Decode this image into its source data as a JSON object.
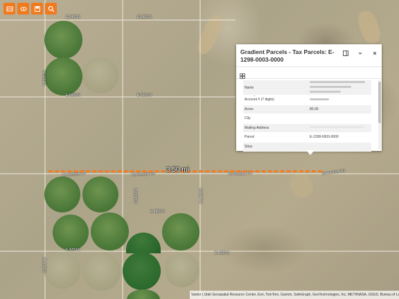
{
  "toolbar": {
    "buttons": [
      {
        "name": "basemap-icon",
        "label": ""
      },
      {
        "name": "layers-icon",
        "label": ""
      },
      {
        "name": "bookmark-icon",
        "label": ""
      },
      {
        "name": "search-icon",
        "label": ""
      }
    ]
  },
  "roads": {
    "e6400n": "E 6400 N",
    "e6400n_2": "E 6400 N",
    "e5600n": "E 5600 N",
    "e5600n_2": "E 5600 N",
    "s3100w": "S 3100 W",
    "w_antelope_rd_1": "W Antelope Rd",
    "w_antelope_rd_2": "W Antelope Rd",
    "w_antelope_rd_3": "W Antelope Rd",
    "w_antelope_rd_4": "W Antelope Rd",
    "e4200n": "E 4200 N",
    "e4800n": "E 4800 N",
    "e4000n": "E 4000 N",
    "s2000w": "S 2000 W",
    "s1400w": "S 1400 W",
    "s1800w": "S 1800 W"
  },
  "measurement": {
    "label": "3.50 mi",
    "color": "#f47c20"
  },
  "popup": {
    "title": "Gradient Parcels - Tax Parcels: E-1298-0003-0000",
    "zoom_to": "Zoom to",
    "rows": [
      {
        "key": "Name",
        "value": ""
      },
      {
        "key": "Account # (7 digits)",
        "value": ""
      },
      {
        "key": "Acres",
        "value": "80.00"
      },
      {
        "key": "City",
        "value": ""
      },
      {
        "key": "Mailing Address",
        "value": ""
      },
      {
        "key": "Parcel",
        "value": "E-1298-0003-0000"
      },
      {
        "key": "Situs",
        "value": ""
      }
    ]
  },
  "attribution": "Vantor | Utah Geospatial Resource Center, Esri, TomTom, Garmin, SafeGraph, GeoTechnologies, Inc, METI/NASA, USGS, Bureau of Land Management, EPA, NPS, US Census Bureau, USDA, USFWS",
  "colors": {
    "accent": "#f07a1e",
    "panel": "#ffffff"
  }
}
